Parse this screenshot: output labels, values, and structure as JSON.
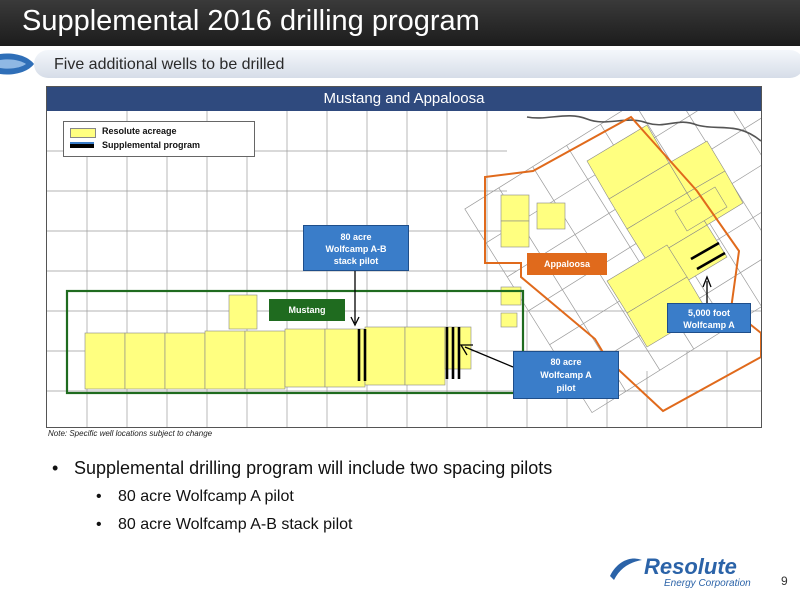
{
  "slide": {
    "title": "Supplemental 2016 drilling program",
    "subtitle": "Five additional wells to be drilled",
    "page_number": "9"
  },
  "map": {
    "header": "Mustang and Appaloosa",
    "legend": {
      "acreage_label": "Resolute acreage",
      "program_label": "Supplemental program",
      "acreage_color": "#ffff80",
      "program_color": "#000000"
    },
    "labels": {
      "mustang": "Mustang",
      "appaloosa": "Appaloosa"
    },
    "callouts": {
      "stack_pilot": [
        "80 acre",
        "Wolfcamp A-B",
        "stack pilot"
      ],
      "wolfcamp_a_pilot": [
        "80 acre",
        "Wolfcamp A",
        "pilot"
      ],
      "five_thousand_foot": [
        "5,000 foot",
        "Wolfcamp A"
      ]
    },
    "colors": {
      "mustang_outline": "#1f6b1f",
      "appaloosa_outline": "#e06a1c",
      "callout_fill": "#3a7dc9",
      "header_fill": "#2f4a7e"
    }
  },
  "note": "Note: Specific well locations subject to change",
  "bullets": {
    "main": "Supplemental drilling program will include two spacing pilots",
    "sub1": "80 acre Wolfcamp A pilot",
    "sub2": "80 acre Wolfcamp A-B stack pilot"
  },
  "logo": {
    "name": "Resolute",
    "tagline": "Energy Corporation"
  }
}
